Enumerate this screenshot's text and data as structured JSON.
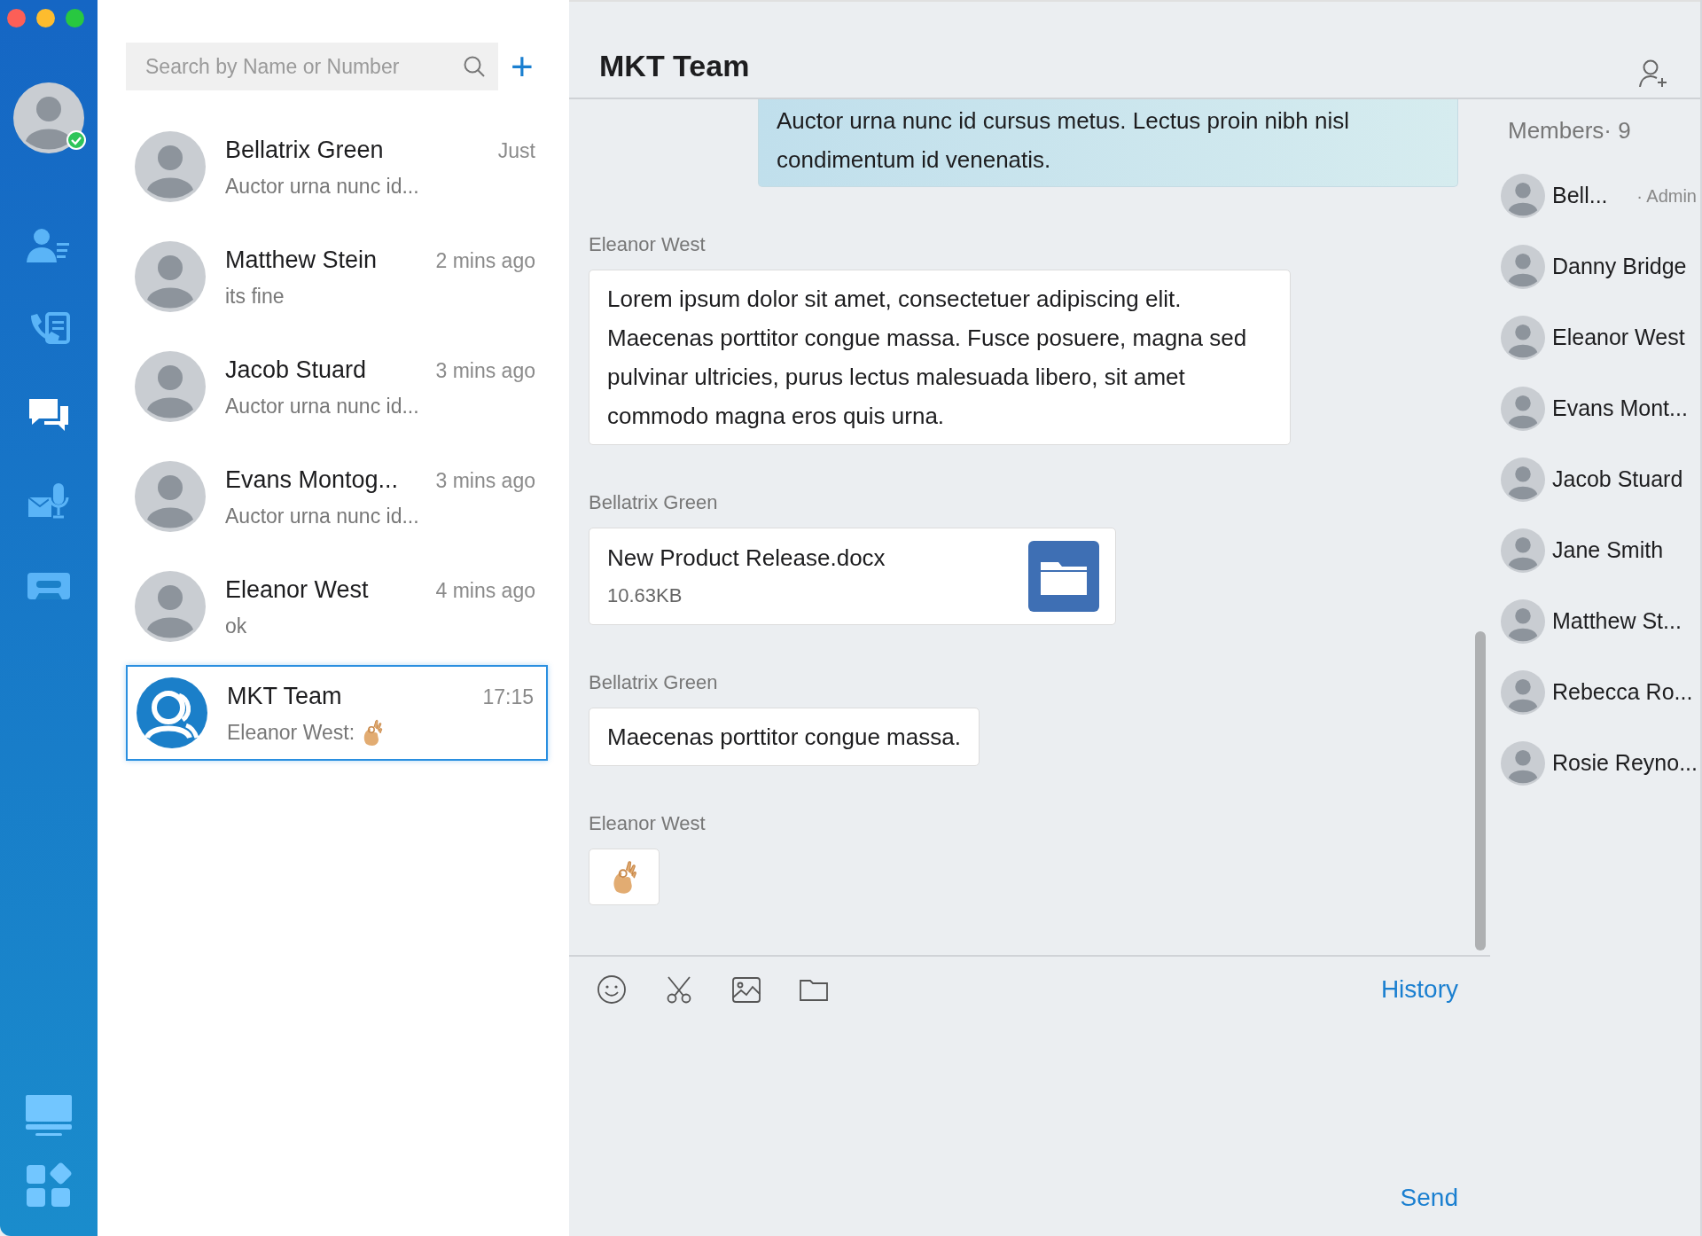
{
  "sidebar": {
    "profile": {
      "online": true
    },
    "nav_items": [
      {
        "kind": "contacts",
        "selected": false
      },
      {
        "kind": "calls",
        "selected": false
      },
      {
        "kind": "chat",
        "selected": true
      },
      {
        "kind": "voicemail",
        "selected": false
      },
      {
        "kind": "cassette",
        "selected": false
      }
    ],
    "bottom_items": [
      {
        "kind": "desktop"
      },
      {
        "kind": "apps"
      }
    ]
  },
  "conversation_list": {
    "search": {
      "placeholder": "Search by Name or Number"
    },
    "add_button": "+",
    "conversations": [
      {
        "name": "Bellatrix Green",
        "time": "Just",
        "preview": "Auctor urna nunc id...",
        "kind": "contact",
        "emoji": false,
        "selected": false
      },
      {
        "name": "Matthew Stein",
        "time": "2 mins ago",
        "preview": "its fine",
        "kind": "contact",
        "emoji": false,
        "selected": false
      },
      {
        "name": "Jacob Stuard",
        "time": "3 mins ago",
        "preview": "Auctor urna nunc id...",
        "kind": "contact",
        "emoji": false,
        "selected": false
      },
      {
        "name": "Evans Montog...",
        "time": "3 mins ago",
        "preview": "Auctor urna nunc id...",
        "kind": "contact",
        "emoji": false,
        "selected": false
      },
      {
        "name": "Eleanor West",
        "time": "4 mins ago",
        "preview": "ok",
        "kind": "contact",
        "emoji": false,
        "selected": false
      },
      {
        "name": "MKT Team",
        "time": "17:15",
        "preview": "Eleanor West:",
        "kind": "group",
        "emoji": true,
        "selected": true
      }
    ]
  },
  "chat": {
    "title": "MKT Team",
    "messages": [
      {
        "kind": "text",
        "outgoing": true,
        "text": "Auctor urna nunc id cursus metus. Lectus proin nibh nisl condimentum id venenatis."
      },
      {
        "kind": "text",
        "outgoing": false,
        "sender": "Eleanor West",
        "text": "Lorem ipsum dolor sit amet, consectetuer adipiscing elit. Maecenas porttitor congue massa. Fusce posuere, magna sed pulvinar ultricies, purus lectus malesuada libero, sit amet commodo magna eros quis urna."
      },
      {
        "kind": "file",
        "outgoing": false,
        "sender": "Bellatrix Green",
        "file_name": "New Product Release.docx",
        "file_size": "10.63KB"
      },
      {
        "kind": "text",
        "outgoing": false,
        "sender": "Bellatrix Green",
        "text": "Maecenas porttitor congue massa."
      },
      {
        "kind": "emoji",
        "outgoing": false,
        "sender": "Eleanor West"
      }
    ],
    "composer": {
      "history": "History",
      "send": "Send"
    }
  },
  "members": {
    "heading": "Members· 9",
    "list": [
      {
        "name": "Bell...",
        "role": "· Admin"
      },
      {
        "name": "Danny Bridge"
      },
      {
        "name": "Eleanor West"
      },
      {
        "name": "Evans Mont..."
      },
      {
        "name": "Jacob Stuard"
      },
      {
        "name": "Jane Smith"
      },
      {
        "name": "Matthew St..."
      },
      {
        "name": "Rebecca Ro..."
      },
      {
        "name": "Rosie Reyno..."
      }
    ]
  }
}
